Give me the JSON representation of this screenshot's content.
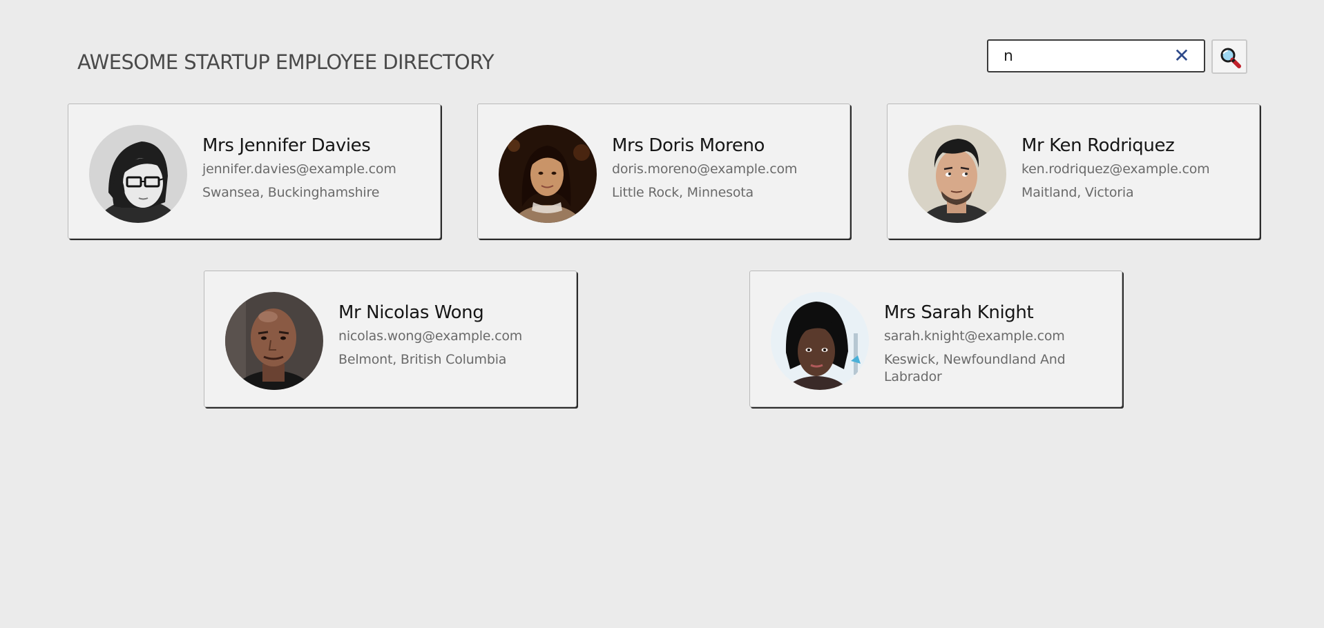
{
  "header": {
    "title": "AWESOME STARTUP EMPLOYEE DIRECTORY"
  },
  "search": {
    "value": "n",
    "clear_icon": "close-icon",
    "button_icon": "magnifier-icon",
    "clear_color": "#2e4a8a"
  },
  "employees": [
    {
      "name": "Mrs Jennifer Davies",
      "email": "jennifer.davies@example.com",
      "location": "Swansea, Buckinghamshire"
    },
    {
      "name": "Mrs Doris Moreno",
      "email": "doris.moreno@example.com",
      "location": "Little Rock, Minnesota"
    },
    {
      "name": "Mr Ken Rodriquez",
      "email": "ken.rodriquez@example.com",
      "location": "Maitland, Victoria"
    },
    {
      "name": "Mr Nicolas Wong",
      "email": "nicolas.wong@example.com",
      "location": "Belmont, British Columbia"
    },
    {
      "name": "Mrs Sarah Knight",
      "email": "sarah.knight@example.com",
      "location": "Keswick, Newfoundland And Labrador"
    }
  ],
  "colors": {
    "background": "#ebebeb",
    "card_background": "#f2f2f2",
    "title_text": "#4a4a4a",
    "secondary_text": "#6a6a6a"
  }
}
